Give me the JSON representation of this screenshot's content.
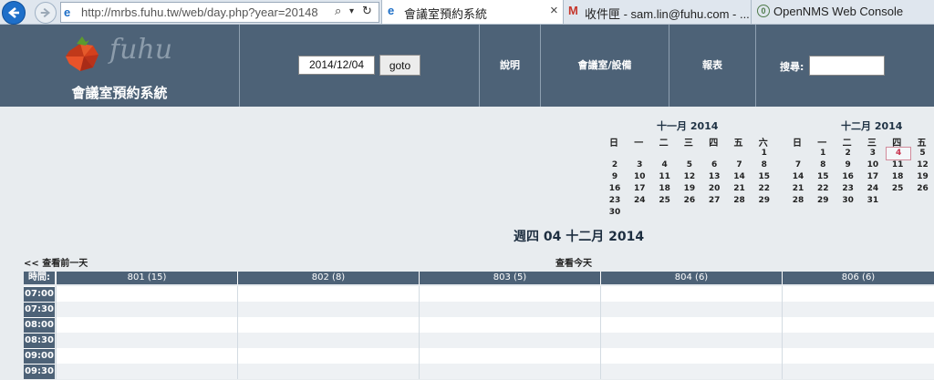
{
  "browser": {
    "url": "http://mrbs.fuhu.tw/web/day.php?year=20148",
    "tabs": [
      {
        "label": "會議室預約系統",
        "active": true
      },
      {
        "label": "收件匣 - sam.lin@fuhu.com - ...",
        "active": false
      },
      {
        "label": "OpenNMS Web Console",
        "active": false
      }
    ],
    "close_glyph": "×"
  },
  "header": {
    "logo_text": "fuhu",
    "site_title": "會議室預約系統",
    "date_value": "2014/12/04",
    "goto_label": "goto",
    "help_label": "說明",
    "rooms_label": "會議室/設備",
    "report_label": "報表",
    "search_label": "搜尋:",
    "colors": {
      "bar": "#4d6277",
      "page": "#e8ecef"
    }
  },
  "calendars": [
    {
      "title": "十一月 2014",
      "dow": [
        "日",
        "一",
        "二",
        "三",
        "四",
        "五",
        "六"
      ],
      "weeks": [
        [
          "",
          "",
          "",
          "",
          "",
          "",
          "1"
        ],
        [
          "2",
          "3",
          "4",
          "5",
          "6",
          "7",
          "8"
        ],
        [
          "9",
          "10",
          "11",
          "12",
          "13",
          "14",
          "15"
        ],
        [
          "16",
          "17",
          "18",
          "19",
          "20",
          "21",
          "22"
        ],
        [
          "23",
          "24",
          "25",
          "26",
          "27",
          "28",
          "29"
        ],
        [
          "30",
          "",
          "",
          "",
          "",
          "",
          ""
        ]
      ]
    },
    {
      "title": "十二月 2014",
      "dow": [
        "日",
        "一",
        "二",
        "三",
        "四",
        "五"
      ],
      "weeks": [
        [
          "",
          "1",
          "2",
          "3",
          "4",
          "5"
        ],
        [
          "7",
          "8",
          "9",
          "10",
          "11",
          "12"
        ],
        [
          "14",
          "15",
          "16",
          "17",
          "18",
          "19"
        ],
        [
          "21",
          "22",
          "23",
          "24",
          "25",
          "26"
        ],
        [
          "28",
          "29",
          "30",
          "31",
          "",
          ""
        ]
      ],
      "today": "4"
    }
  ],
  "day": {
    "title": "週四 04 十二月 2014",
    "prev_label": "<< 查看前一天",
    "today_label": "查看今天"
  },
  "grid": {
    "time_header": "時間:",
    "rooms": [
      "801 (15)",
      "802 (8)",
      "803 (5)",
      "804 (6)",
      "806 (6)"
    ],
    "times": [
      "07:00",
      "07:30",
      "08:00",
      "08:30",
      "09:00",
      "09:30"
    ]
  }
}
